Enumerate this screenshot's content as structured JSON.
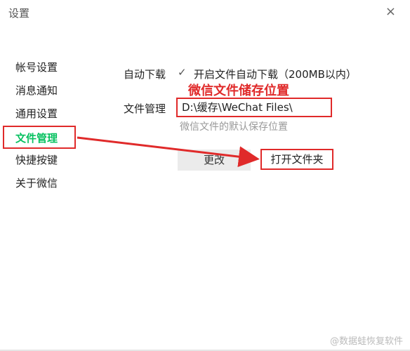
{
  "window": {
    "title": "设置",
    "close_glyph": "×"
  },
  "sidebar": {
    "items": [
      {
        "label": "帐号设置"
      },
      {
        "label": "消息通知"
      },
      {
        "label": "通用设置"
      },
      {
        "label": "文件管理",
        "active": true
      },
      {
        "label": "快捷按键"
      },
      {
        "label": "关于微信"
      }
    ]
  },
  "auto_download": {
    "label": "自动下载",
    "checkbox_label": "开启文件自动下载（200MB以内）",
    "checked": true
  },
  "annotation_text": "微信文件储存位置",
  "file_management": {
    "label": "文件管理",
    "path": "D:\\缓存\\WeChat Files\\",
    "hint": "微信文件的默认保存位置"
  },
  "buttons": {
    "change_label": "更改",
    "open_folder_label": "打开文件夹"
  },
  "watermark": "@数据蛙恢复软件",
  "colors": {
    "accent_green": "#07c160",
    "highlight_red": "#e02a2a"
  }
}
